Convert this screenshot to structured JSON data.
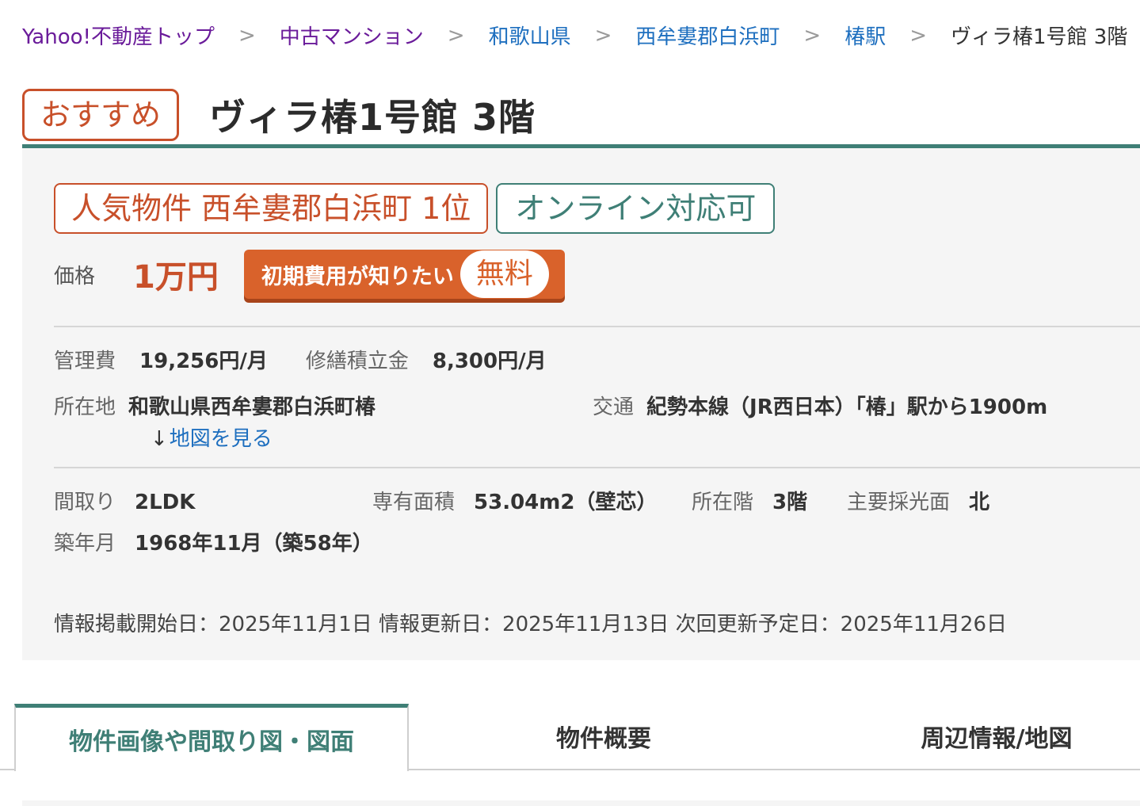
{
  "breadcrumb": {
    "items": [
      {
        "label": "Yahoo!不動産トップ"
      },
      {
        "label": "中古マンション"
      },
      {
        "label": "和歌山県"
      },
      {
        "label": "西牟婁郡白浜町"
      },
      {
        "label": "椿駅"
      }
    ],
    "current": "ヴィラ椿1号館 3階",
    "separator": ">"
  },
  "header": {
    "badge": "おすすめ",
    "title": "ヴィラ椿1号館 3階"
  },
  "badges": {
    "rank": "人気物件 西牟婁郡白浜町 1位",
    "online": "オンライン対応可"
  },
  "price": {
    "label": "価格",
    "value": "1万円",
    "cta_label": "初期費用が知りたい",
    "cta_free": "無料"
  },
  "fees": {
    "management_label": "管理費",
    "management_value": "19,256円/月",
    "repair_label": "修繕積立金",
    "repair_value": "8,300円/月"
  },
  "location": {
    "address_label": "所在地",
    "address_value": "和歌山県西牟婁郡白浜町椿",
    "map_link": "地図を見る",
    "access_label": "交通",
    "access_value": "紀勢本線（JR西日本）「椿」駅から1900m"
  },
  "specs": {
    "layout_label": "間取り",
    "layout_value": "2LDK",
    "area_label": "専有面積",
    "area_value": "53.04m2（壁芯）",
    "floor_label": "所在階",
    "floor_value": "3階",
    "light_label": "主要採光面",
    "light_value": "北",
    "built_label": "築年月",
    "built_value": "1968年11月（築58年）"
  },
  "dates": {
    "text": "情報掲載開始日：2025年11月1日 情報更新日：2025年11月13日 次回更新予定日：2025年11月26日"
  },
  "tabs": [
    {
      "label": "物件画像や間取り図・図面",
      "active": true
    },
    {
      "label": "物件概要",
      "active": false
    },
    {
      "label": "周辺情報/地図",
      "active": false
    }
  ],
  "colors": {
    "accent_orange": "#c8502a",
    "accent_green": "#3f7f76",
    "link_blue": "#1e6fbf",
    "link_visited": "#6a1b9a"
  }
}
